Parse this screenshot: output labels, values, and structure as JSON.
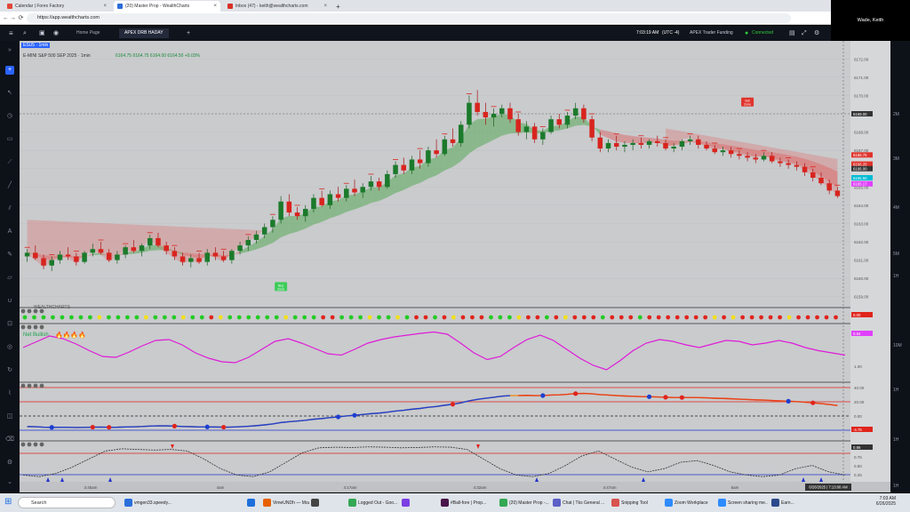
{
  "browser": {
    "tabs": [
      {
        "label": "Calendar | Forex Factory",
        "color": "#e3473a"
      },
      {
        "label": "(20) Master Prop - WealthCharts",
        "color": "#2b6cd9"
      },
      {
        "label": "Inbox (47) - keith@wealthcharts.com",
        "color": "#d93025"
      }
    ],
    "url": "https://app.wealthcharts.com",
    "new_tab": "+",
    "back": "←",
    "forward": "→",
    "reload": "⟳"
  },
  "video": {
    "user_name": "Wade, Keith"
  },
  "app_header": {
    "tabs": [
      "Home Page",
      "APEX DRB HADAY"
    ],
    "time": "7:03:19 AM",
    "timezone": "(UTC -4)",
    "account": "APEX Trader Funding",
    "status": "Connected",
    "status_color": "#2ecc40"
  },
  "chart_title": "E-MINI S&P 500 SEP 2025 · 1min",
  "chart_ohlc": "6164.75  6164.75  6164.00  6164.50  +0.03%",
  "symbol_badge": "ESU5 · 1min",
  "net_bullish_label": "Net Bullish",
  "wealthcharts_label": "WEALTHCHARTS",
  "chart_data": {
    "type": "candlestick",
    "price_axis_ticks": [
      "6172.00",
      "6171.00",
      "6170.00",
      "6169.00",
      "6168.00",
      "6167.00",
      "6166.00",
      "6165.00",
      "6164.00",
      "6163.00",
      "6162.00",
      "6161.00",
      "6160.00",
      "6159.00"
    ],
    "price_tags": [
      {
        "label": "6169.00",
        "color": "#333333"
      },
      {
        "label": "6166.75",
        "color": "#e0342c"
      },
      {
        "label": "6166.25",
        "color": "#e0342c"
      },
      {
        "label": "6166.00",
        "color": "#333333"
      },
      {
        "label": "6165.50",
        "color": "#00bcd4"
      },
      {
        "label": "6165.17",
        "color": "#e040fb"
      }
    ],
    "ylim": [
      6158.5,
      6172.5
    ],
    "time_labels": [
      "3:45am",
      "4am",
      "4:17am",
      "4:32am",
      "4:47am",
      "5am"
    ],
    "date_label": "6/26/2025 | 7:13:00 AM",
    "candles": [
      [
        6161.2,
        6161.6,
        6160.9,
        6161.4
      ],
      [
        6161.4,
        6161.8,
        6161.0,
        6161.1
      ],
      [
        6161.1,
        6161.3,
        6160.5,
        6160.7
      ],
      [
        6160.7,
        6161.2,
        6160.4,
        6161.0
      ],
      [
        6161.0,
        6161.5,
        6160.8,
        6161.3
      ],
      [
        6161.3,
        6161.7,
        6161.0,
        6161.2
      ],
      [
        6161.2,
        6161.4,
        6160.7,
        6160.9
      ],
      [
        6160.9,
        6161.5,
        6160.8,
        6161.4
      ],
      [
        6161.4,
        6161.9,
        6161.2,
        6161.6
      ],
      [
        6161.6,
        6162.0,
        6161.3,
        6161.4
      ],
      [
        6161.4,
        6161.6,
        6160.9,
        6161.0
      ],
      [
        6161.0,
        6161.5,
        6160.8,
        6161.3
      ],
      [
        6161.3,
        6161.8,
        6161.1,
        6161.7
      ],
      [
        6161.7,
        6162.1,
        6161.4,
        6161.5
      ],
      [
        6161.5,
        6161.9,
        6161.2,
        6161.8
      ],
      [
        6161.8,
        6162.4,
        6161.6,
        6162.2
      ],
      [
        6162.2,
        6162.5,
        6161.7,
        6161.8
      ],
      [
        6161.8,
        6162.0,
        6161.3,
        6161.5
      ],
      [
        6161.5,
        6161.7,
        6161.0,
        6161.2
      ],
      [
        6161.2,
        6161.4,
        6160.7,
        6160.9
      ],
      [
        6160.9,
        6161.3,
        6160.6,
        6161.1
      ],
      [
        6161.1,
        6161.4,
        6160.8,
        6160.9
      ],
      [
        6160.9,
        6161.6,
        6160.7,
        6161.4
      ],
      [
        6161.4,
        6161.7,
        6161.0,
        6161.2
      ],
      [
        6161.2,
        6161.5,
        6160.9,
        6161.0
      ],
      [
        6161.0,
        6161.6,
        6160.8,
        6161.5
      ],
      [
        6161.5,
        6162.0,
        6161.3,
        6161.8
      ],
      [
        6161.8,
        6162.3,
        6161.5,
        6162.1
      ],
      [
        6162.1,
        6162.6,
        6161.9,
        6162.4
      ],
      [
        6162.4,
        6163.0,
        6162.2,
        6162.8
      ],
      [
        6162.8,
        6163.4,
        6162.5,
        6163.2
      ],
      [
        6163.2,
        6164.5,
        6163.0,
        6164.2
      ],
      [
        6164.2,
        6164.6,
        6163.4,
        6163.6
      ],
      [
        6163.6,
        6163.9,
        6163.2,
        6163.4
      ],
      [
        6163.4,
        6164.0,
        6163.1,
        6163.8
      ],
      [
        6163.8,
        6164.6,
        6163.6,
        6164.4
      ],
      [
        6164.4,
        6164.8,
        6163.9,
        6164.0
      ],
      [
        6164.0,
        6164.8,
        6163.8,
        6164.6
      ],
      [
        6164.6,
        6165.0,
        6164.2,
        6164.4
      ],
      [
        6164.4,
        6165.1,
        6164.2,
        6164.9
      ],
      [
        6164.9,
        6165.4,
        6164.5,
        6164.7
      ],
      [
        6164.7,
        6165.2,
        6164.4,
        6165.0
      ],
      [
        6165.0,
        6165.6,
        6164.8,
        6165.3
      ],
      [
        6165.3,
        6165.5,
        6164.8,
        6165.0
      ],
      [
        6165.0,
        6165.9,
        6164.9,
        6165.7
      ],
      [
        6165.7,
        6166.4,
        6165.5,
        6166.2
      ],
      [
        6166.2,
        6166.6,
        6165.7,
        6165.9
      ],
      [
        6165.9,
        6166.7,
        6165.7,
        6166.5
      ],
      [
        6166.5,
        6167.0,
        6166.0,
        6166.3
      ],
      [
        6166.3,
        6167.2,
        6166.1,
        6167.0
      ],
      [
        6167.0,
        6167.6,
        6166.6,
        6166.8
      ],
      [
        6166.8,
        6167.8,
        6166.7,
        6167.6
      ],
      [
        6167.6,
        6168.2,
        6167.2,
        6167.4
      ],
      [
        6167.4,
        6168.6,
        6167.2,
        6168.4
      ],
      [
        6168.4,
        6170.0,
        6168.2,
        6169.6
      ],
      [
        6169.6,
        6170.3,
        6168.9,
        6169.1
      ],
      [
        6169.1,
        6169.6,
        6168.4,
        6168.8
      ],
      [
        6168.8,
        6169.3,
        6168.3,
        6169.0
      ],
      [
        6169.0,
        6169.5,
        6168.8,
        6169.3
      ],
      [
        6169.3,
        6169.6,
        6168.5,
        6168.7
      ],
      [
        6168.7,
        6169.0,
        6167.8,
        6168.0
      ],
      [
        6168.0,
        6168.6,
        6167.6,
        6168.3
      ],
      [
        6168.3,
        6168.5,
        6167.4,
        6167.6
      ],
      [
        6167.6,
        6168.2,
        6167.3,
        6168.0
      ],
      [
        6168.0,
        6168.9,
        6167.9,
        6168.7
      ],
      [
        6168.7,
        6169.0,
        6168.2,
        6168.4
      ],
      [
        6168.4,
        6169.1,
        6168.2,
        6168.9
      ],
      [
        6168.9,
        6169.6,
        6168.7,
        6169.3
      ],
      [
        6169.3,
        6169.5,
        6168.5,
        6168.7
      ],
      [
        6168.7,
        6168.9,
        6167.5,
        6167.7
      ],
      [
        6167.7,
        6168.0,
        6166.9,
        6167.1
      ],
      [
        6167.1,
        6167.6,
        6166.9,
        6167.4
      ],
      [
        6167.4,
        6167.8,
        6167.0,
        6167.2
      ],
      [
        6167.2,
        6167.5,
        6166.9,
        6167.3
      ],
      [
        6167.3,
        6167.6,
        6167.0,
        6167.4
      ],
      [
        6167.4,
        6167.7,
        6167.1,
        6167.3
      ],
      [
        6167.3,
        6167.6,
        6167.1,
        6167.5
      ],
      [
        6167.5,
        6167.8,
        6167.2,
        6167.4
      ],
      [
        6167.4,
        6167.6,
        6167.0,
        6167.1
      ],
      [
        6167.1,
        6167.4,
        6166.9,
        6167.2
      ],
      [
        6167.2,
        6167.6,
        6167.0,
        6167.5
      ],
      [
        6167.5,
        6167.8,
        6167.3,
        6167.6
      ],
      [
        6167.6,
        6167.8,
        6167.1,
        6167.3
      ],
      [
        6167.3,
        6167.5,
        6167.0,
        6167.1
      ],
      [
        6167.1,
        6167.3,
        6166.8,
        6166.9
      ],
      [
        6166.9,
        6167.2,
        6166.7,
        6167.0
      ],
      [
        6167.0,
        6167.2,
        6166.6,
        6166.8
      ],
      [
        6166.8,
        6167.0,
        6166.5,
        6166.7
      ],
      [
        6166.7,
        6166.9,
        6166.4,
        6166.6
      ],
      [
        6166.6,
        6166.8,
        6166.3,
        6166.5
      ],
      [
        6166.5,
        6166.9,
        6166.4,
        6166.7
      ],
      [
        6166.7,
        6166.9,
        6166.3,
        6166.4
      ],
      [
        6166.4,
        6166.6,
        6166.1,
        6166.3
      ],
      [
        6166.3,
        6166.5,
        6166.0,
        6166.2
      ],
      [
        6166.2,
        6166.4,
        6165.9,
        6166.1
      ],
      [
        6166.1,
        6166.3,
        6165.6,
        6165.8
      ],
      [
        6165.8,
        6166.0,
        6165.3,
        6165.5
      ],
      [
        6165.5,
        6165.8,
        6165.1,
        6165.2
      ],
      [
        6165.2,
        6165.4,
        6164.6,
        6164.8
      ],
      [
        6164.8,
        6165.0,
        6164.4,
        6164.5
      ]
    ],
    "annotations": [
      {
        "text": "Buy Zone",
        "color": "#2ecc40"
      },
      {
        "text": "Sell Zone",
        "color": "#e0342c"
      }
    ],
    "panes": [
      {
        "name": "dots",
        "value_tag": "0.00"
      },
      {
        "name": "oscillator",
        "value_tag": "0.94",
        "ticks": [
          "1.00"
        ]
      },
      {
        "name": "trend",
        "value_tag": "-4.75",
        "ticks": [
          "40.00",
          "20.00",
          "0.00",
          "-20.00"
        ]
      },
      {
        "name": "cycle",
        "value_tag": "0.86",
        "ticks": [
          "0.75",
          "0.50",
          "0.25"
        ]
      }
    ],
    "osc_values": [
      0.62,
      0.75,
      0.88,
      0.82,
      0.7,
      0.55,
      0.42,
      0.4,
      0.52,
      0.66,
      0.78,
      0.8,
      0.68,
      0.5,
      0.38,
      0.3,
      0.28,
      0.4,
      0.58,
      0.76,
      0.82,
      0.72,
      0.6,
      0.48,
      0.45,
      0.58,
      0.72,
      0.8,
      0.86,
      0.9,
      0.94,
      0.97,
      0.92,
      0.72,
      0.5,
      0.35,
      0.42,
      0.62,
      0.8,
      0.9,
      0.78,
      0.58,
      0.38,
      0.22,
      0.12,
      0.32,
      0.55,
      0.72,
      0.8,
      0.76,
      0.68,
      0.62,
      0.7,
      0.78,
      0.76,
      0.68,
      0.72,
      0.78,
      0.72,
      0.62,
      0.55,
      0.5,
      0.45
    ],
    "dots_colors": [
      "g",
      "g",
      "g",
      "g",
      "g",
      "g",
      "g",
      "g",
      "y",
      "g",
      "g",
      "g",
      "g",
      "y",
      "g",
      "g",
      "g",
      "y",
      "g",
      "g",
      "r",
      "y",
      "g",
      "g",
      "g",
      "g",
      "g",
      "g",
      "y",
      "g",
      "g",
      "g",
      "r",
      "r",
      "g",
      "g",
      "g",
      "y",
      "g",
      "g",
      "y",
      "g",
      "r",
      "r",
      "g",
      "r",
      "y",
      "r",
      "r",
      "r",
      "g",
      "g",
      "g",
      "y",
      "r",
      "r",
      "g",
      "r",
      "y",
      "r",
      "r",
      "r",
      "g",
      "r",
      "r",
      "r",
      "g",
      "r",
      "r",
      "r",
      "r",
      "r",
      "r",
      "r",
      "y",
      "r",
      "y",
      "r",
      "r",
      "r",
      "r",
      "r",
      "y",
      "r",
      "r",
      "r",
      "r",
      "r"
    ]
  },
  "right_times": [
    "2M",
    "3M",
    "4M",
    "5M",
    "1H",
    "10M",
    "1H",
    "1H",
    "1H"
  ],
  "taskbar": {
    "search_placeholder": "Search",
    "items": [
      {
        "label": "vmgen33.speedy...",
        "color": "#2a6fdb"
      },
      {
        "label": "",
        "color": "#1d6fdc"
      },
      {
        "label": "VimeUNDh — Mozi...",
        "color": "#e66000"
      },
      {
        "label": "",
        "color": "#444444"
      },
      {
        "label": "Logged Out - Goo...",
        "color": "#34a853"
      },
      {
        "label": "",
        "color": "#7b3fe4"
      },
      {
        "label": "#Ball-fore | Prop...",
        "color": "#4a154b"
      },
      {
        "label": "(20) Master Prop -...",
        "color": "#34a853"
      },
      {
        "label": "Chat | Tks General ...",
        "color": "#5b5fc7"
      },
      {
        "label": "Snipping Tool",
        "color": "#d9534f"
      },
      {
        "label": "Zoom Workplace",
        "color": "#2d8cff"
      },
      {
        "label": "Screen sharing me...",
        "color": "#2d8cff"
      },
      {
        "label": "Earn...",
        "color": "#2b4a8b"
      }
    ],
    "clock_time": "7:03 AM",
    "clock_date": "6/26/2025"
  }
}
